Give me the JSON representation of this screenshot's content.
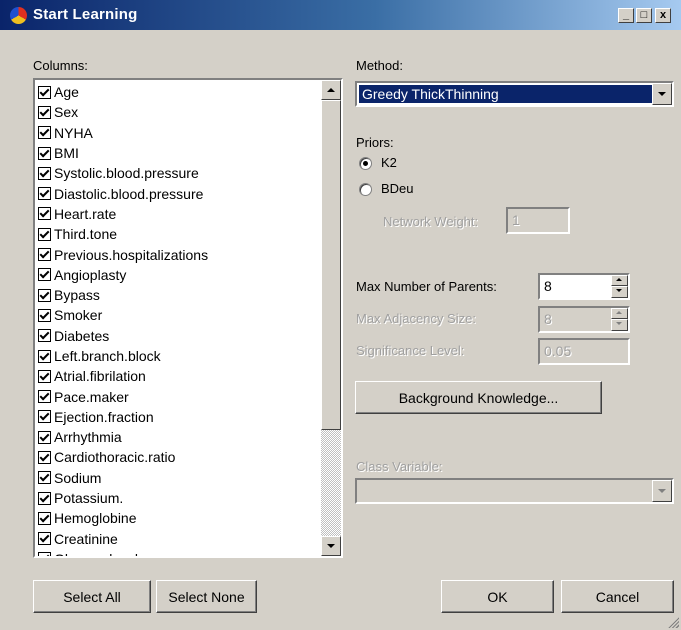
{
  "window": {
    "title": "Start Learning",
    "controls": {
      "minimize": "_",
      "maximize": "□",
      "close": "x"
    }
  },
  "columns": {
    "label": "Columns:",
    "items": [
      "Age",
      "Sex",
      "NYHA",
      "BMI",
      "Systolic.blood.pressure",
      "Diastolic.blood.pressure",
      "Heart.rate",
      "Third.tone",
      "Previous.hospitalizations",
      "Angioplasty",
      "Bypass",
      "Smoker",
      "Diabetes",
      "Left.branch.block",
      "Atrial.fibrilation",
      "Pace.maker",
      "Ejection.fraction",
      "Arrhythmia",
      "Cardiothoracic.ratio",
      "Sodium",
      "Potassium.",
      "Hemoglobine",
      "Creatinine",
      "Glucose.level"
    ],
    "all_checked": true
  },
  "method": {
    "label": "Method:",
    "value": "Greedy ThickThinning"
  },
  "priors": {
    "label": "Priors:",
    "options": [
      {
        "label": "K2",
        "selected": true
      },
      {
        "label": "BDeu",
        "selected": false
      }
    ],
    "network_weight_label": "Network Weight:",
    "network_weight_value": "1"
  },
  "params": {
    "max_parents_label": "Max Number of Parents:",
    "max_parents_value": "8",
    "max_adjacency_label": "Max Adjacency Size:",
    "max_adjacency_value": "8",
    "significance_label": "Significance Level:",
    "significance_value": "0.05"
  },
  "background_knowledge_button": "Background Knowledge...",
  "class_variable": {
    "label": "Class Variable:",
    "value": ""
  },
  "buttons": {
    "select_all": "Select All",
    "select_none": "Select None",
    "ok": "OK",
    "cancel": "Cancel"
  },
  "colors": {
    "titlebar_start": "#0a246a",
    "titlebar_end": "#a6caf0",
    "dialog_bg": "#d4d0c8",
    "selection_bg": "#0a246a"
  }
}
